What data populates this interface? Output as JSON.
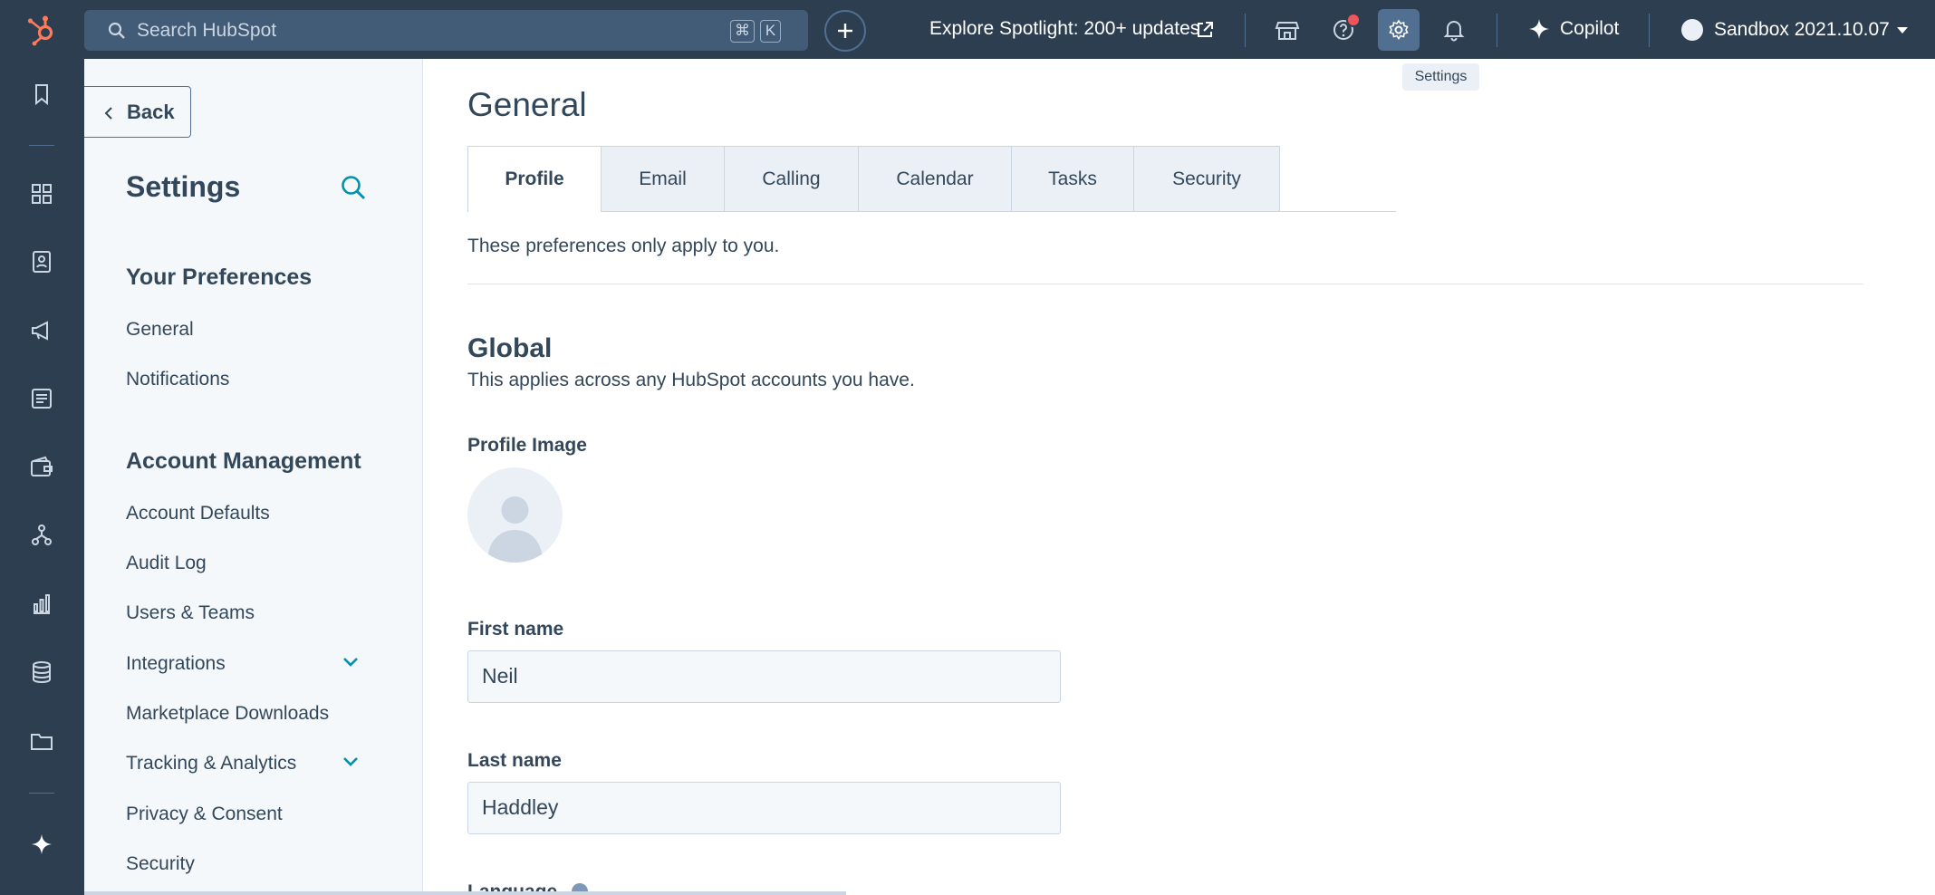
{
  "topnav": {
    "search_placeholder": "Search HubSpot",
    "shortcut_cmd": "⌘",
    "shortcut_key": "K",
    "spotlight": "Explore Spotlight: 200+ updates",
    "copilot": "Copilot",
    "account": "Sandbox 2021.10.07",
    "settings_tooltip": "Settings"
  },
  "sidebar": {
    "back": "Back",
    "title": "Settings",
    "sections": [
      {
        "heading": "Your Preferences",
        "items": [
          "General",
          "Notifications"
        ]
      },
      {
        "heading": "Account Management",
        "items": [
          "Account Defaults",
          "Audit Log",
          "Users & Teams",
          "Integrations",
          "Marketplace Downloads",
          "Tracking & Analytics",
          "Privacy & Consent",
          "Security"
        ]
      }
    ]
  },
  "main": {
    "title": "General",
    "tabs": [
      "Profile",
      "Email",
      "Calling",
      "Calendar",
      "Tasks",
      "Security"
    ],
    "active_tab": "Profile",
    "note": "These preferences only apply to you.",
    "global_heading": "Global",
    "global_sub": "This applies across any HubSpot accounts you have.",
    "profile_image_label": "Profile Image",
    "first_name_label": "First name",
    "first_name": "Neil",
    "last_name_label": "Last name",
    "last_name": "Haddley",
    "language_label": "Language"
  },
  "colors": {
    "nav_bg": "#2d3e50",
    "brand_orange": "#ff7a59",
    "link_teal": "#0091ae",
    "text": "#33475b"
  }
}
